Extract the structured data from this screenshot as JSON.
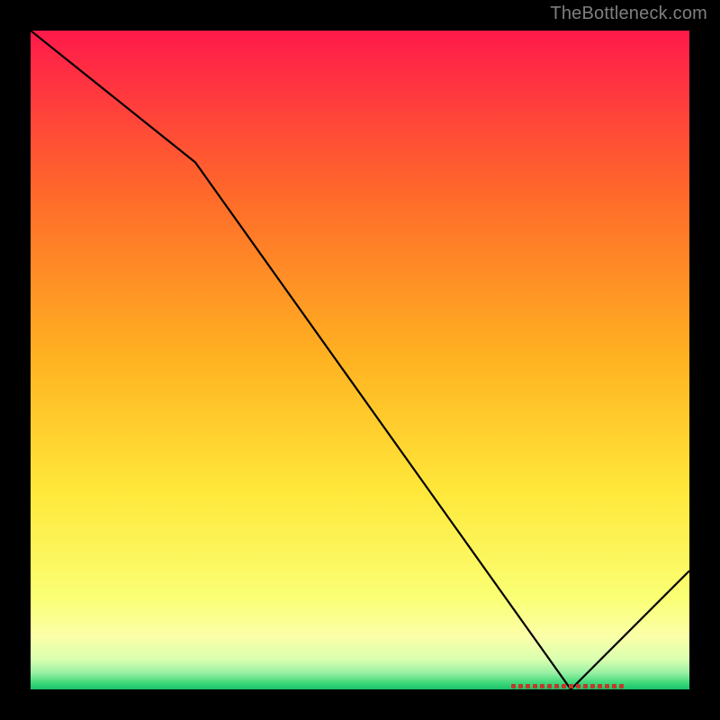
{
  "watermark": "TheBottleneck.com",
  "chart_data": {
    "type": "line",
    "title": "",
    "xlabel": "",
    "ylabel": "",
    "xlim": [
      0,
      100
    ],
    "ylim": [
      0,
      100
    ],
    "x": [
      0,
      25,
      82,
      100
    ],
    "values": [
      100,
      80,
      0,
      18
    ],
    "marker_band": {
      "x_start": 73,
      "x_end": 90,
      "y": 0
    },
    "gradient_stops": [
      {
        "offset": 0.0,
        "color": "#ff1a4b"
      },
      {
        "offset": 0.25,
        "color": "#ff6a2a"
      },
      {
        "offset": 0.5,
        "color": "#ffb321"
      },
      {
        "offset": 0.7,
        "color": "#ffe83a"
      },
      {
        "offset": 0.86,
        "color": "#faff74"
      },
      {
        "offset": 0.92,
        "color": "#fbffa8"
      },
      {
        "offset": 0.955,
        "color": "#d9ffb0"
      },
      {
        "offset": 0.975,
        "color": "#98f0a2"
      },
      {
        "offset": 0.99,
        "color": "#3fd87a"
      },
      {
        "offset": 1.0,
        "color": "#19c26a"
      }
    ]
  }
}
